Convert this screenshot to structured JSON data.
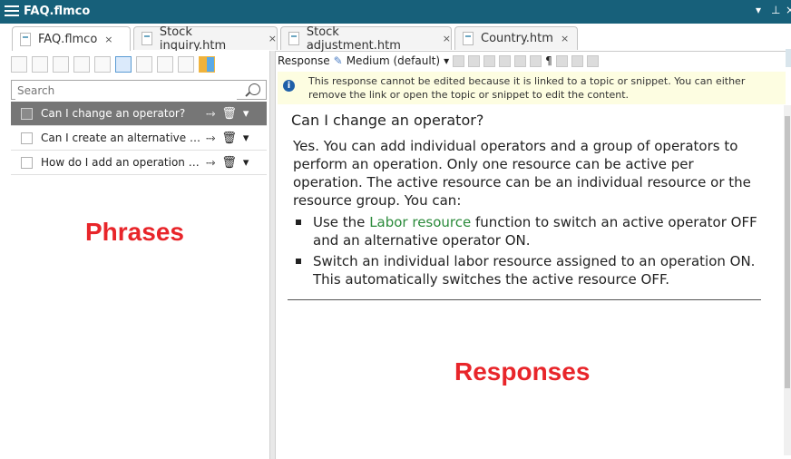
{
  "window": {
    "title": "FAQ.flmco",
    "controls": {
      "dropdown": "▾",
      "pin": "⊥",
      "close": "×"
    }
  },
  "tabs": [
    {
      "label": "FAQ.flmco",
      "close": "×"
    },
    {
      "label": "Stock inquiry.htm",
      "close": "×"
    },
    {
      "label": "Stock adjustment.htm",
      "close": "×"
    },
    {
      "label": "Country.htm",
      "close": "×"
    }
  ],
  "phrases_panel": {
    "search_placeholder": "Search",
    "items": [
      {
        "text": "Can I change an operator?",
        "selected": true
      },
      {
        "text": "Can I create an alternative or s...",
        "selected": false
      },
      {
        "text": "How do I add an operation to...",
        "selected": false
      }
    ],
    "row_controls": {
      "link": "⤑",
      "delete": "🗑",
      "menu": "▾"
    },
    "overlay_label": "Phrases"
  },
  "response_panel": {
    "toolbar": {
      "response_label": "Response",
      "medium_label": "Medium (default)",
      "dropdown": "▾",
      "pilcrow": "¶"
    },
    "info_message": "This response cannot be edited because it is linked to a topic or snippet. You can either remove the link or open the topic or snippet to edit the content.",
    "title": "Can I change an operator?",
    "body": "Yes. You can add individual operators and a group of operators to perform an operation. Only one resource can be active per operation. The active resource can be an individual resource or the resource group. You can:",
    "bullets": [
      {
        "prefix": "Use the ",
        "link": "Labor resource",
        "suffix": " function to switch an active operator OFF and an alternative operator ON."
      },
      {
        "prefix": "Switch an individual labor resource assigned to an operation ON. This automatically switches the active resource OFF.",
        "link": "",
        "suffix": ""
      }
    ],
    "overlay_label": "Responses"
  },
  "colors": {
    "titlebar": "#17607a",
    "link": "#2a8a3a",
    "overlay": "#e8252a",
    "selected_row": "#767676"
  }
}
